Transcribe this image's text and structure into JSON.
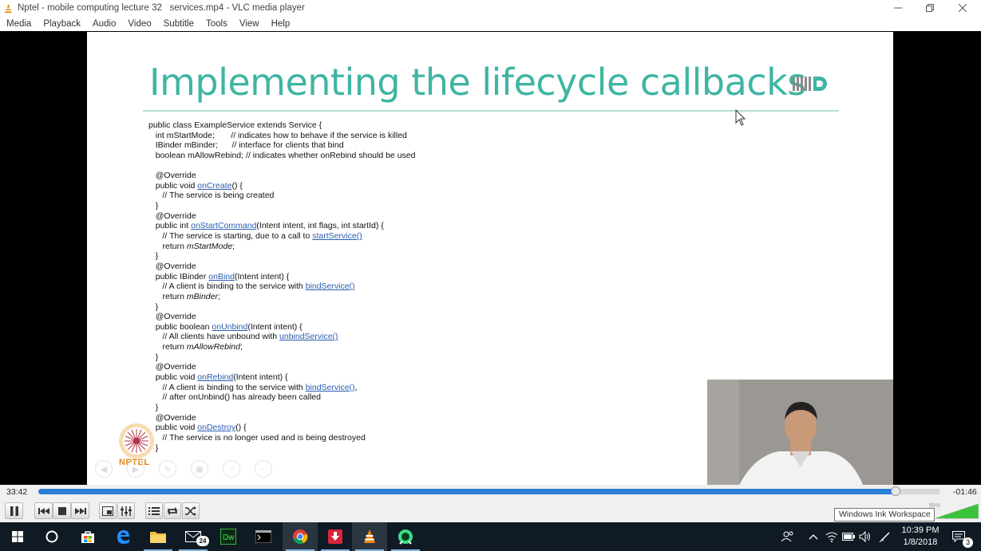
{
  "window": {
    "title": "Nptel - mobile computing lecture 32   services.mp4 - VLC media player",
    "minimize_icon": "minimize-icon",
    "restore_icon": "restore-icon",
    "close_icon": "close-icon"
  },
  "menu": [
    "Media",
    "Playback",
    "Audio",
    "Video",
    "Subtitle",
    "Tools",
    "View",
    "Help"
  ],
  "slide": {
    "title": "Implementing the lifecycle callbacks",
    "logo_text": "NPTEL",
    "title_color": "#3fb5a3",
    "code": [
      [
        {
          "t": "public class ExampleService extends Service {"
        }
      ],
      [
        {
          "t": "   int mStartMode;       // indicates how to behave if the service is killed"
        }
      ],
      [
        {
          "t": "   IBinder mBinder;      // interface for clients that bind"
        }
      ],
      [
        {
          "t": "   boolean mAllowRebind; // indicates whether onRebind should be used"
        }
      ],
      [
        {
          "t": ""
        }
      ],
      [
        {
          "t": "   @Override"
        }
      ],
      [
        {
          "t": "   public void "
        },
        {
          "t": "onCreate",
          "k": "lnk"
        },
        {
          "t": "() {"
        }
      ],
      [
        {
          "t": "      // The service is being created"
        }
      ],
      [
        {
          "t": "   }"
        }
      ],
      [
        {
          "t": "   @Override"
        }
      ],
      [
        {
          "t": "   public int "
        },
        {
          "t": "onStartCommand",
          "k": "lnk"
        },
        {
          "t": "(Intent intent, int flags, int startId) {"
        }
      ],
      [
        {
          "t": "      // The service is starting, due to a call to "
        },
        {
          "t": "startService()",
          "k": "lnk"
        }
      ],
      [
        {
          "t": "      return "
        },
        {
          "t": "mStartMode",
          "k": "it"
        },
        {
          "t": ";"
        }
      ],
      [
        {
          "t": "   }"
        }
      ],
      [
        {
          "t": "   @Override"
        }
      ],
      [
        {
          "t": "   public IBinder "
        },
        {
          "t": "onBind",
          "k": "lnk"
        },
        {
          "t": "(Intent intent) {"
        }
      ],
      [
        {
          "t": "      // A client is binding to the service with "
        },
        {
          "t": "bindService()",
          "k": "lnk"
        }
      ],
      [
        {
          "t": "      return "
        },
        {
          "t": "mBinder",
          "k": "it"
        },
        {
          "t": ";"
        }
      ],
      [
        {
          "t": "   }"
        }
      ],
      [
        {
          "t": "   @Override"
        }
      ],
      [
        {
          "t": "   public boolean "
        },
        {
          "t": "onUnbind",
          "k": "lnk"
        },
        {
          "t": "(Intent intent) {"
        }
      ],
      [
        {
          "t": "      // All clients have unbound with "
        },
        {
          "t": "unbindService()",
          "k": "lnk"
        }
      ],
      [
        {
          "t": "      return "
        },
        {
          "t": "mAllowRebind",
          "k": "it"
        },
        {
          "t": ";"
        }
      ],
      [
        {
          "t": "   }"
        }
      ],
      [
        {
          "t": "   @Override"
        }
      ],
      [
        {
          "t": "   public void "
        },
        {
          "t": "onRebind",
          "k": "lnk"
        },
        {
          "t": "(Intent intent) {"
        }
      ],
      [
        {
          "t": "      // A client is binding to the service with "
        },
        {
          "t": "bindService()",
          "k": "lnk"
        },
        {
          "t": ","
        }
      ],
      [
        {
          "t": "      // after onUnbind() has already been called"
        }
      ],
      [
        {
          "t": "   }"
        }
      ],
      [
        {
          "t": "   @Override"
        }
      ],
      [
        {
          "t": "   public void "
        },
        {
          "t": "onDestroy",
          "k": "lnk"
        },
        {
          "t": "() {"
        }
      ],
      [
        {
          "t": "      // The service is no longer used and is being destroyed"
        }
      ],
      [
        {
          "t": "   }"
        }
      ]
    ]
  },
  "player": {
    "time_elapsed": "33:42",
    "time_remaining": "-01:46",
    "progress": 0.95,
    "volume_label": "99%",
    "volume_level": 0.99,
    "ink_tooltip": "Windows Ink Workspace",
    "accent_color": "#2c7fd6"
  },
  "taskbar": {
    "mail_badge": "24",
    "time": "10:39 PM",
    "date": "1/8/2018",
    "notifications": "3"
  }
}
